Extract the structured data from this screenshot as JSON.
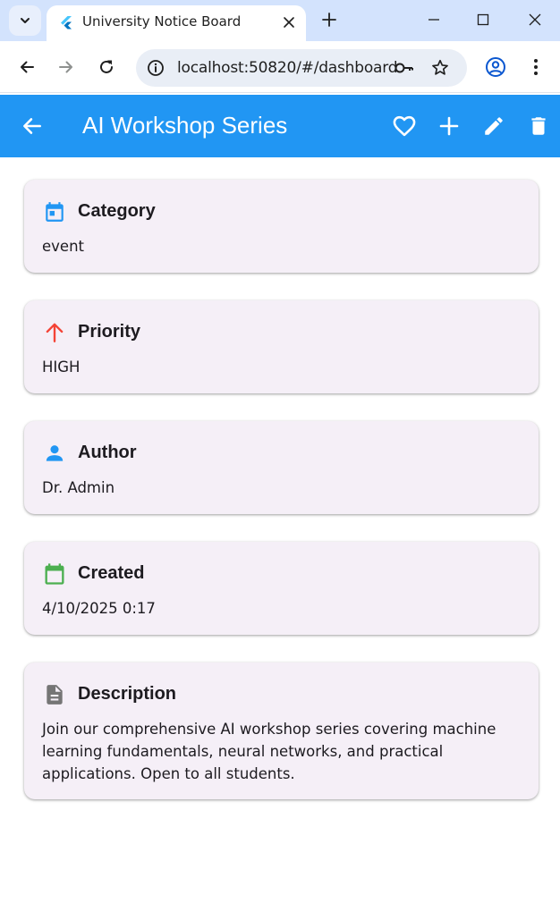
{
  "browser": {
    "tab_title": "University Notice Board",
    "url": "localhost:50820/#/dashboard"
  },
  "app": {
    "title": "AI Workshop Series",
    "colors": {
      "appbar": "#2196f3",
      "card_bg": "#f5eff7",
      "category_icon": "#2196f3",
      "priority_icon": "#f44336",
      "author_icon": "#2196f3",
      "created_icon": "#4caf50",
      "description_icon": "#757575"
    },
    "actions": [
      "favorite-icon",
      "add-icon",
      "edit-icon",
      "delete-icon"
    ]
  },
  "details": {
    "category": {
      "label": "Category",
      "value": "event",
      "icon": "calendar-icon"
    },
    "priority": {
      "label": "Priority",
      "value": "HIGH",
      "icon": "arrow-up-icon"
    },
    "author": {
      "label": "Author",
      "value": "Dr. Admin",
      "icon": "person-icon"
    },
    "created": {
      "label": "Created",
      "value": "4/10/2025 0:17",
      "icon": "calendar-outline-icon"
    },
    "description": {
      "label": "Description",
      "value": "Join our comprehensive AI workshop series covering machine learning fundamentals, neural networks, and practical applications. Open to all students.",
      "icon": "document-icon"
    }
  }
}
